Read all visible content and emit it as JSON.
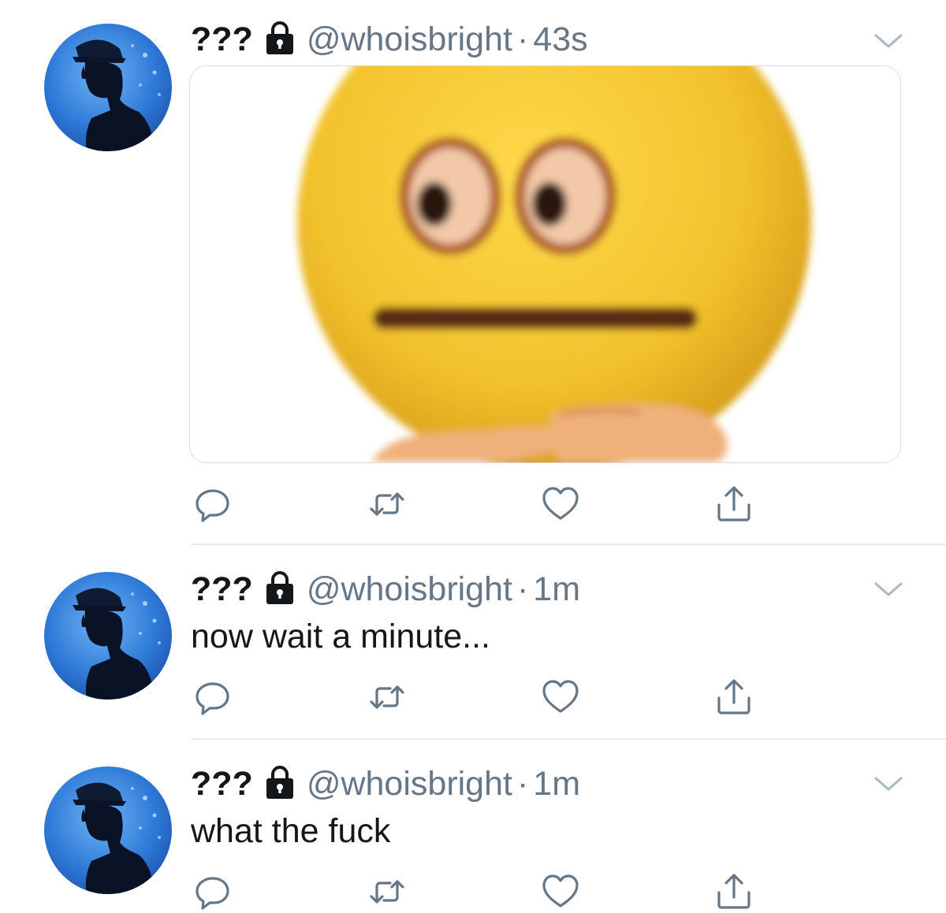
{
  "colors": {
    "text": "#14171a",
    "secondary": "#657786",
    "icon": "#657786",
    "divider": "#e6ecf0",
    "avatar_blue": "#3d86e0",
    "emoji_yellow": "#f4c430"
  },
  "tweets": [
    {
      "name": "???",
      "handle": "@whoisbright",
      "separator": "·",
      "time": "43s",
      "text": "",
      "has_media": true,
      "media_description_icon": "emoji-hmm-image",
      "actions": [
        "reply-icon",
        "retweet-icon",
        "like-icon",
        "share-icon"
      ]
    },
    {
      "name": "???",
      "handle": "@whoisbright",
      "separator": "·",
      "time": "1m",
      "text": "now wait a minute...",
      "has_media": false,
      "actions": [
        "reply-icon",
        "retweet-icon",
        "like-icon",
        "share-icon"
      ]
    },
    {
      "name": "???",
      "handle": "@whoisbright",
      "separator": "·",
      "time": "1m",
      "text": "what the fuck",
      "has_media": false,
      "actions": [
        "reply-icon",
        "retweet-icon",
        "like-icon",
        "share-icon"
      ]
    }
  ]
}
